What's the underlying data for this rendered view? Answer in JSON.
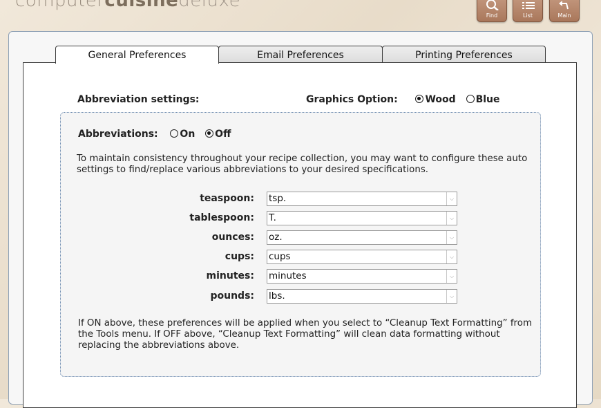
{
  "app": {
    "brand_parts": [
      "computer",
      "cuisine",
      "deluxe"
    ]
  },
  "toolbar": {
    "find_label": "Find",
    "list_label": "List",
    "main_label": "Main"
  },
  "tabs": [
    {
      "label": "General Preferences",
      "active": true
    },
    {
      "label": "Email Preferences",
      "active": false
    },
    {
      "label": "Printing Preferences",
      "active": false
    }
  ],
  "abbreviation_settings": {
    "title": "Abbreviation settings:",
    "toggle_label": "Abbreviations:",
    "on_label": "On",
    "off_label": "Off",
    "selected": "Off",
    "intro_text": "To maintain consistency throughout your recipe collection, you may want to configure these auto settings to find/replace various abbreviations to your desired specifications.",
    "rows": [
      {
        "label": "teaspoon:",
        "value": "tsp."
      },
      {
        "label": "tablespoon:",
        "value": "T."
      },
      {
        "label": "ounces:",
        "value": "oz."
      },
      {
        "label": "cups:",
        "value": "cups"
      },
      {
        "label": "minutes:",
        "value": "minutes"
      },
      {
        "label": "pounds:",
        "value": "lbs."
      }
    ],
    "footer_text": "If ON above, these preferences will be applied when you select to “Cleanup Text Formatting” from the Tools menu. If OFF above, “Cleanup Text Formatting” will clean data formatting without replacing the abbreviations above."
  },
  "graphics": {
    "label": "Graphics Option:",
    "wood_label": "Wood",
    "blue_label": "Blue",
    "selected": "Wood"
  },
  "colors": {
    "button_brown": "#b08263",
    "box_border": "#5d7fa8"
  }
}
